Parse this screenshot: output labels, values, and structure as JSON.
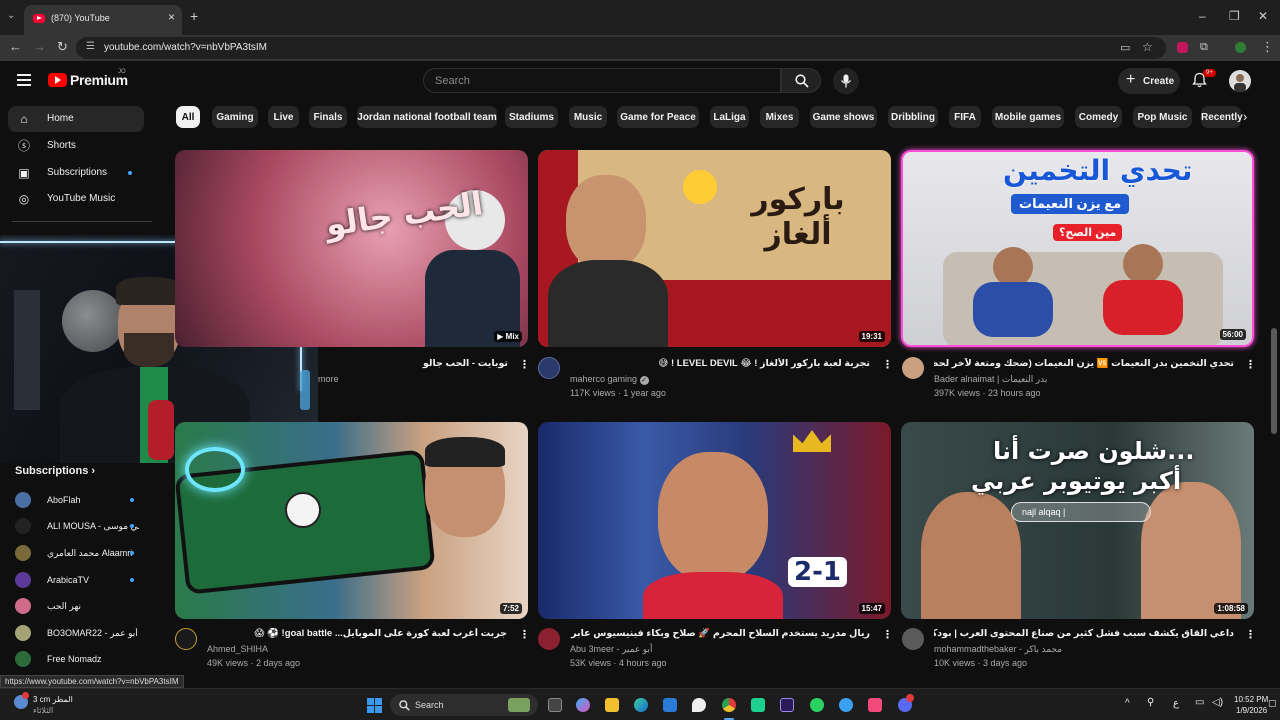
{
  "browser": {
    "tab_title": "(870) YouTube",
    "url": "youtube.com/watch?v=nbVbPA3tsIM",
    "status_url": "https://www.youtube.com/watch?v=nbVbPA3tsIM",
    "window_controls": [
      "–",
      "❐",
      "✕"
    ]
  },
  "masthead": {
    "logo_text": "Premium",
    "country_code": "JO",
    "search_placeholder": "Search",
    "create_label": "Create",
    "notif_badge": "9+"
  },
  "sidebar": {
    "items": [
      {
        "label": "Home",
        "icon": "home-icon"
      },
      {
        "label": "Shorts",
        "icon": "shorts-icon"
      },
      {
        "label": "Subscriptions",
        "icon": "subscriptions-icon"
      },
      {
        "label": "YouTube Music",
        "icon": "youtube-music-icon"
      }
    ],
    "subscriptions_heading": "Subscriptions",
    "subscriptions": [
      {
        "name": "AboFlah",
        "color": "#4a6fa5",
        "dot": true
      },
      {
        "name": "ALI MOUSA - علي موسى",
        "color": "#222222",
        "dot": true
      },
      {
        "name": "محمد العامري Alaamri",
        "color": "#7a6a3a",
        "dot": true
      },
      {
        "name": "ArabicaTV",
        "color": "#5b3a9a",
        "dot": true
      },
      {
        "name": "نهر الحب",
        "color": "#d06a8a",
        "dot": false
      },
      {
        "name": "BO3OMAR22 - أبو عمر",
        "color": "#a3a375",
        "dot": false
      },
      {
        "name": "Free Nomadz",
        "color": "#2d6a3a",
        "dot": false
      }
    ]
  },
  "chips": [
    "All",
    "Gaming",
    "Live",
    "Finals",
    "Jordan national football team",
    "Stadiums",
    "Music",
    "Game for Peace",
    "LaLiga",
    "Mixes",
    "Game shows",
    "Dribbling",
    "FIFA",
    "Mobile games",
    "Comedy",
    "Pop Music",
    "Recently"
  ],
  "videos": [
    {
      "title": "توبايت - الحب جالو",
      "channel": "",
      "meta": "more",
      "duration": "",
      "badge": "Mix",
      "thumb_text": "الحب جالو"
    },
    {
      "title": "تجربة لعبة باركور الألغاز ! 😂 LEVEL DEVIL ! 😅",
      "channel": "maherco gaming",
      "meta": "117K views · 1 year ago",
      "duration": "19:31",
      "thumb_text": "باركور ألغاز"
    },
    {
      "title": "تحدي التخمين بدر النعيمات 🆚 يزن النعيمات (ضحك ومتعة لآخر لحظة) 😂 🔥",
      "channel": "Bader alnaimat | بدر النعيمات",
      "meta": "397K views · 23 hours ago",
      "duration": "56:00",
      "thumb_text": "تحدي التخمين",
      "thumb_sub": "مع يزن النعيمات",
      "thumb_q": "مين الصح؟"
    },
    {
      "title": "جربت أغرب لعبة كورة على الموبايل... goal battle! ⚽ 😱",
      "channel": "Ahmed_SHIHA",
      "meta": "49K views · 2 days ago",
      "duration": "7:52"
    },
    {
      "title": "ريال مدريد يستخدم السلاح المحرم 🚀 صلاح وبكاء فينيسيوس عابر القارات 😲",
      "channel": "Abu 3meer - أبو عمير",
      "meta": "53K views · 4 hours ago",
      "duration": "15:47",
      "thumb_score": "2-1"
    },
    {
      "title": "داعي القاق يكشف سبب فشل كثير من صناع المحتوى العرب | بودكاست الخوارزمي",
      "channel": "mohammadthebaker - محمد باكر",
      "meta": "10K views · 3 days ago",
      "duration": "1:08:58",
      "thumb_text": "شلون صرت أنا...",
      "thumb_text2": "أكبر يوتيوبر عربي",
      "thumb_search": "najl alqaq |"
    }
  ],
  "taskbar": {
    "weather_temp": "3 cm",
    "weather_text": "المطر",
    "weather_sub": "الثلاثاء",
    "search_label": "Search",
    "time": "10:52 PM",
    "date": "1/9/2026",
    "lang": "ع"
  },
  "colors": {
    "bg": "#0f0f0f",
    "chip_bg": "#272727",
    "accent_red": "#ff0000",
    "dot_blue": "#3ea6ff"
  }
}
